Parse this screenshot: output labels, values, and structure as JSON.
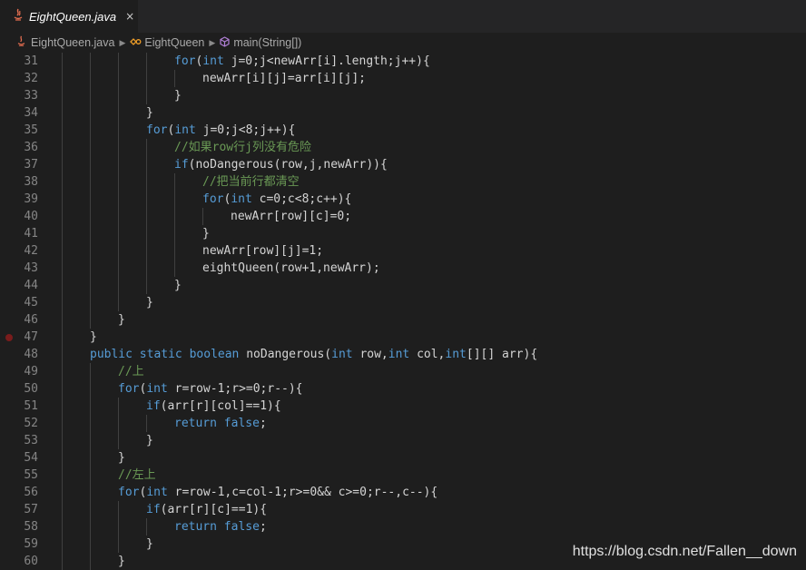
{
  "tab": {
    "label": "EightQueen.java",
    "close": "×"
  },
  "breadcrumb": {
    "file": "EightQueen.java",
    "class": "EightQueen",
    "method": "main(String[])"
  },
  "watermark": "https://blog.csdn.net/Fallen__down",
  "colors": {
    "keyword": "#569cd6",
    "comment": "#6a9955",
    "number": "#b5cea8",
    "text": "#d4d4d4"
  },
  "lines": [
    {
      "n": "31",
      "indent": 4,
      "code": "for(int j=0;j<newArr[i].length;j++){"
    },
    {
      "n": "32",
      "indent": 5,
      "code": "newArr[i][j]=arr[i][j];"
    },
    {
      "n": "33",
      "indent": 4,
      "code": "}"
    },
    {
      "n": "34",
      "indent": 3,
      "code": "}"
    },
    {
      "n": "35",
      "indent": 3,
      "code": "for(int j=0;j<8;j++){"
    },
    {
      "n": "36",
      "indent": 4,
      "code": "//如果row行j列没有危险"
    },
    {
      "n": "37",
      "indent": 4,
      "code": "if(noDangerous(row,j,newArr)){"
    },
    {
      "n": "38",
      "indent": 5,
      "code": "//把当前行都清空"
    },
    {
      "n": "39",
      "indent": 5,
      "code": "for(int c=0;c<8;c++){"
    },
    {
      "n": "40",
      "indent": 6,
      "code": "newArr[row][c]=0;"
    },
    {
      "n": "41",
      "indent": 5,
      "code": "}"
    },
    {
      "n": "42",
      "indent": 5,
      "code": "newArr[row][j]=1;"
    },
    {
      "n": "43",
      "indent": 5,
      "code": "eightQueen(row+1,newArr);"
    },
    {
      "n": "44",
      "indent": 4,
      "code": "}"
    },
    {
      "n": "45",
      "indent": 3,
      "code": "}"
    },
    {
      "n": "46",
      "indent": 2,
      "code": "}"
    },
    {
      "n": "47",
      "indent": 1,
      "code": "}"
    },
    {
      "n": "48",
      "indent": 1,
      "code": "public static boolean noDangerous(int row,int col,int[][] arr){"
    },
    {
      "n": "49",
      "indent": 2,
      "code": "//上"
    },
    {
      "n": "50",
      "indent": 2,
      "code": "for(int r=row-1;r>=0;r--){"
    },
    {
      "n": "51",
      "indent": 3,
      "code": "if(arr[r][col]==1){"
    },
    {
      "n": "52",
      "indent": 4,
      "code": "return false;"
    },
    {
      "n": "53",
      "indent": 3,
      "code": "}"
    },
    {
      "n": "54",
      "indent": 2,
      "code": "}"
    },
    {
      "n": "55",
      "indent": 2,
      "code": "//左上"
    },
    {
      "n": "56",
      "indent": 2,
      "code": "for(int r=row-1,c=col-1;r>=0&& c>=0;r--,c--){"
    },
    {
      "n": "57",
      "indent": 3,
      "code": "if(arr[r][c]==1){"
    },
    {
      "n": "58",
      "indent": 4,
      "code": "return false;"
    },
    {
      "n": "59",
      "indent": 3,
      "code": "}"
    },
    {
      "n": "60",
      "indent": 2,
      "code": "}"
    }
  ]
}
